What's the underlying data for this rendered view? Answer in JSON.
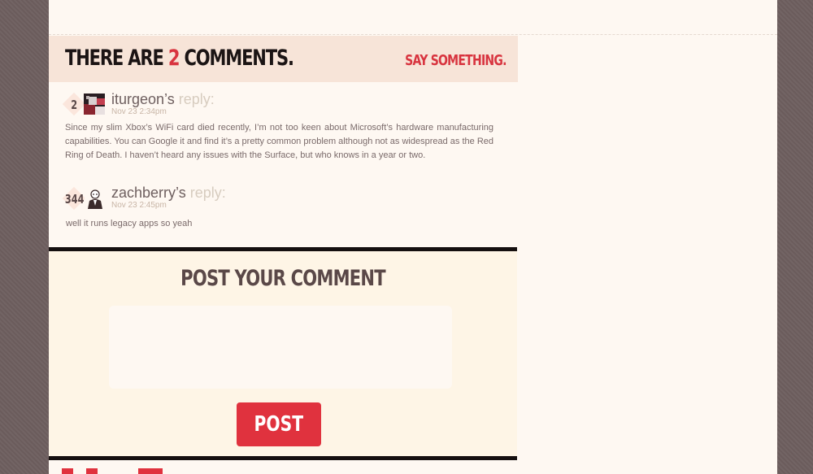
{
  "comments_header": {
    "prefix": "THERE ARE ",
    "count": "2",
    "suffix": " COMMENTS.",
    "say_something": "SAY SOMETHING."
  },
  "comments": [
    {
      "rank": "2",
      "author": "iturgeon’s",
      "reply_label": "reply:",
      "date": "Nov 23 2:34pm",
      "body": "Since my slim Xbox’s WiFi card died recently, I’m not too keen about Microsoft’s hardware manufacturing capabilities. You can Google it and find it’s a pretty common problem although not as widespread as the Red Ring of Death. I haven’t heard any issues with the Surface, but who knows in a year or two."
    },
    {
      "rank": "344",
      "author": "zachberry’s",
      "reply_label": "reply:",
      "date": "Nov 23 2:45pm",
      "body": "well it runs legacy apps so yeah"
    }
  ],
  "post_form": {
    "title": "POST YOUR COMMENT",
    "textarea_value": "",
    "button_label": "POST"
  },
  "colors": {
    "accent": "#d8343f",
    "background": "#6e5f5f",
    "page": "#fef8f2",
    "header_band": "#f7e4d8"
  }
}
